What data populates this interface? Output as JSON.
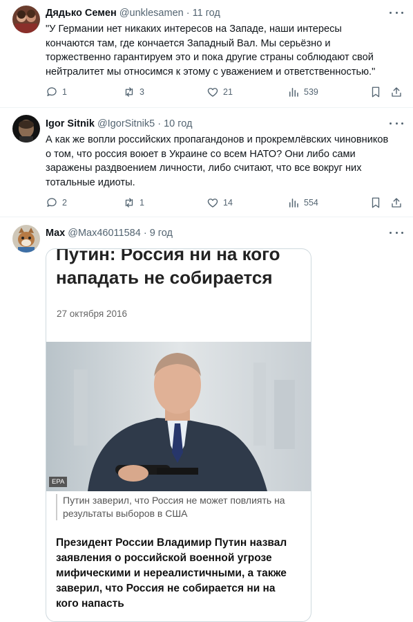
{
  "tweets": [
    {
      "name": "Дядько Семен",
      "handle": "@unklesamen",
      "time": "11 год",
      "text": "\"У Германии нет никаких интересов на Западе, наши интересы кончаются там, где кончается Западный Вал. Мы серьёзно и торжественно гарантируем это и пока другие страны соблюдают свой нейтралитет мы относимся к этому с уважением и ответственностью.\"",
      "replies": "1",
      "reposts": "3",
      "likes": "21",
      "views": "539"
    },
    {
      "name": "Igor Sitnik",
      "handle": "@IgorSitnik5",
      "time": "10 год",
      "text": "А как же вопли российских пропагандонов и прокремлёвских чиновников о том, что россия воюет в Украине со всем НАТО? Они либо сами заражены раздвоением личности, либо считают, что все вокруг них тотальные идиоты.",
      "replies": "2",
      "reposts": "1",
      "likes": "14",
      "views": "554"
    },
    {
      "name": "Max",
      "handle": "@Max46011584",
      "time": "9 год"
    }
  ],
  "separator": "·",
  "card": {
    "headline_line1": "Путин: Россия ни на кого",
    "headline_line2": "нападать не собирается",
    "date": "27 октября 2016",
    "photo_credit": "EPA",
    "caption": "Путин заверил, что Россия не может повлиять на результаты выборов в США",
    "lead": "Президент России Владимир Путин назвал заявления о российской военной угрозе мифическими и нереалистичными, а также заверил, что Россия не собирается ни на кого напасть"
  },
  "icons": [
    "reply-icon",
    "repost-icon",
    "like-icon",
    "views-icon",
    "bookmark-icon",
    "share-icon",
    "more-icon"
  ],
  "colors": {
    "text": "#0f1419",
    "secondary": "#536471",
    "border": "#eff3f4"
  }
}
